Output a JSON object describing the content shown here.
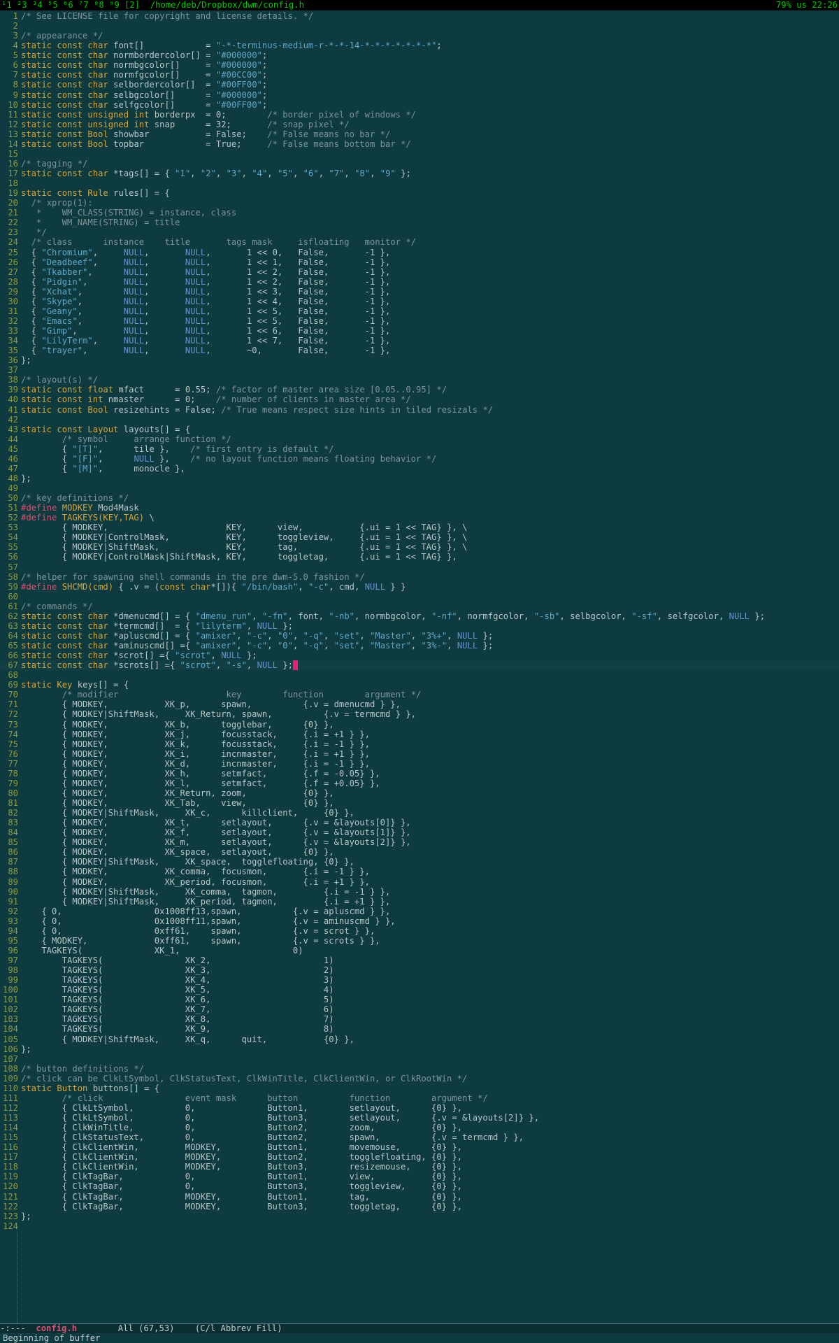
{
  "topbar": {
    "tags": "¹1 ²3 ³4 ⁵5 ⁶6 ⁷7 ⁸8 ⁹9 [2]",
    "path": "/home/deb/Dropbox/dwm/config.h",
    "status": "79% us 22:26"
  },
  "colors": {
    "background": "#0d3b3f",
    "keyword": "#d7a63a",
    "string": "#5fa8c8",
    "comment": "#7e9499",
    "line_number": "#8d9a43",
    "cursor": "#e8207a",
    "topbar_text": "#00cc00"
  },
  "editor": {
    "cursor_line": 67,
    "lines": [
      "/* See LICENSE file for copyright and license details. */",
      "",
      "/* appearance */",
      "static const char font[]            = \"-*-terminus-medium-r-*-*-14-*-*-*-*-*-*-*\";",
      "static const char normbordercolor[] = \"#000000\";",
      "static const char normbgcolor[]     = \"#000000\";",
      "static const char normfgcolor[]     = \"#00CC00\";",
      "static const char selbordercolor[]  = \"#00FF00\";",
      "static const char selbgcolor[]      = \"#000000\";",
      "static const char selfgcolor[]      = \"#00FF00\";",
      "static const unsigned int borderpx  = 0;        /* border pixel of windows */",
      "static const unsigned int snap      = 32;       /* snap pixel */",
      "static const Bool showbar           = False;    /* False means no bar */",
      "static const Bool topbar            = True;     /* False means bottom bar */",
      "",
      "/* tagging */",
      "static const char *tags[] = { \"1\", \"2\", \"3\", \"4\", \"5\", \"6\", \"7\", \"8\", \"9\" };",
      "",
      "static const Rule rules[] = {",
      "  /* xprop(1):",
      "   *    WM_CLASS(STRING) = instance, class",
      "   *    WM_NAME(STRING) = title",
      "   */",
      "  /* class      instance    title       tags mask     isfloating   monitor */",
      "  { \"Chromium\",     NULL,       NULL,       1 << 0,   False,       -1 },",
      "  { \"Deadbeef\",     NULL,       NULL,       1 << 1,   False,       -1 },",
      "  { \"Tkabber\",      NULL,       NULL,       1 << 2,   False,       -1 },",
      "  { \"Pidgin\",       NULL,       NULL,       1 << 2,   False,       -1 },",
      "  { \"Xchat\",        NULL,       NULL,       1 << 3,   False,       -1 },",
      "  { \"Skype\",        NULL,       NULL,       1 << 4,   False,       -1 },",
      "  { \"Geany\",        NULL,       NULL,       1 << 5,   False,       -1 },",
      "  { \"Emacs\",        NULL,       NULL,       1 << 5,   False,       -1 },",
      "  { \"Gimp\",         NULL,       NULL,       1 << 6,   False,       -1 },",
      "  { \"LilyTerm\",     NULL,       NULL,       1 << 7,   False,       -1 },",
      "  { \"trayer\",       NULL,       NULL,       ~0,       False,       -1 },",
      "};",
      "",
      "/* layout(s) */",
      "static const float mfact      = 0.55; /* factor of master area size [0.05..0.95] */",
      "static const int nmaster      = 0;    /* number of clients in master area */",
      "static const Bool resizehints = False; /* True means respect size hints in tiled resizals */",
      "",
      "static const Layout layouts[] = {",
      "        /* symbol     arrange function */",
      "        { \"[T]\",      tile },    /* first entry is default */",
      "        { \"[F]\",      NULL },    /* no layout function means floating behavior */",
      "        { \"[M]\",      monocle },",
      "};",
      "",
      "/* key definitions */",
      "#define MODKEY Mod4Mask",
      "#define TAGKEYS(KEY,TAG) \\",
      "        { MODKEY,                       KEY,      view,           {.ui = 1 << TAG} }, \\",
      "        { MODKEY|ControlMask,           KEY,      toggleview,     {.ui = 1 << TAG} }, \\",
      "        { MODKEY|ShiftMask,             KEY,      tag,            {.ui = 1 << TAG} }, \\",
      "        { MODKEY|ControlMask|ShiftMask, KEY,      toggletag,      {.ui = 1 << TAG} },",
      "",
      "/* helper for spawning shell commands in the pre dwm-5.0 fashion */",
      "#define SHCMD(cmd) { .v = (const char*[]){ \"/bin/bash\", \"-c\", cmd, NULL } }",
      "",
      "/* commands */",
      "static const char *dmenucmd[] = { \"dmenu_run\", \"-fn\", font, \"-nb\", normbgcolor, \"-nf\", normfgcolor, \"-sb\", selbgcolor, \"-sf\", selfgcolor, NULL };",
      "static const char *termcmd[]  = { \"lilyterm\", NULL };",
      "static const char *apluscmd[] = { \"amixer\", \"-c\", \"0\", \"-q\", \"set\", \"Master\", \"3%+\", NULL };",
      "static const char *aminuscmd[] ={ \"amixer\", \"-c\", \"0\", \"-q\", \"set\", \"Master\", \"3%-\", NULL };",
      "static const char *scrot[] ={ \"scrot\", NULL };",
      "static const char *scrots[] ={ \"scrot\", \"-s\", NULL };",
      "",
      "static Key keys[] = {",
      "        /* modifier                     key        function        argument */",
      "        { MODKEY,           XK_p,      spawn,          {.v = dmenucmd } },",
      "        { MODKEY|ShiftMask,     XK_Return, spawn,          {.v = termcmd } },",
      "        { MODKEY,           XK_b,      togglebar,      {0} },",
      "        { MODKEY,           XK_j,      focusstack,     {.i = +1 } },",
      "        { MODKEY,           XK_k,      focusstack,     {.i = -1 } },",
      "        { MODKEY,           XK_i,      incnmaster,     {.i = +1 } },",
      "        { MODKEY,           XK_d,      incnmaster,     {.i = -1 } },",
      "        { MODKEY,           XK_h,      setmfact,       {.f = -0.05} },",
      "        { MODKEY,           XK_l,      setmfact,       {.f = +0.05} },",
      "        { MODKEY,           XK_Return, zoom,           {0} },",
      "        { MODKEY,           XK_Tab,    view,           {0} },",
      "        { MODKEY|ShiftMask,     XK_c,      killclient,     {0} },",
      "        { MODKEY,           XK_t,      setlayout,      {.v = &layouts[0]} },",
      "        { MODKEY,           XK_f,      setlayout,      {.v = &layouts[1]} },",
      "        { MODKEY,           XK_m,      setlayout,      {.v = &layouts[2]} },",
      "        { MODKEY,           XK_space,  setlayout,      {0} },",
      "        { MODKEY|ShiftMask,     XK_space,  togglefloating, {0} },",
      "        { MODKEY,           XK_comma,  focusmon,       {.i = -1 } },",
      "        { MODKEY,           XK_period, focusmon,       {.i = +1 } },",
      "        { MODKEY|ShiftMask,     XK_comma,  tagmon,         {.i = -1 } },",
      "        { MODKEY|ShiftMask,     XK_period, tagmon,         {.i = +1 } },",
      "    { 0,                  0x1008ff13,spawn,          {.v = apluscmd } },",
      "    { 0,                  0x1008ff11,spawn,          {.v = aminuscmd } },",
      "    { 0,                  0xff61,    spawn,          {.v = scrot } },",
      "    { MODKEY,             0xff61,    spawn,          {.v = scrots } },",
      "    TAGKEYS(              XK_1,                      0)",
      "        TAGKEYS(                XK_2,                      1)",
      "        TAGKEYS(                XK_3,                      2)",
      "        TAGKEYS(                XK_4,                      3)",
      "        TAGKEYS(                XK_5,                      4)",
      "        TAGKEYS(                XK_6,                      5)",
      "        TAGKEYS(                XK_7,                      6)",
      "        TAGKEYS(                XK_8,                      7)",
      "        TAGKEYS(                XK_9,                      8)",
      "        { MODKEY|ShiftMask,     XK_q,      quit,           {0} },",
      "};",
      "",
      "/* button definitions */",
      "/* click can be ClkLtSymbol, ClkStatusText, ClkWinTitle, ClkClientWin, or ClkRootWin */",
      "static Button buttons[] = {",
      "        /* click                event mask      button          function        argument */",
      "        { ClkLtSymbol,          0,              Button1,        setlayout,      {0} },",
      "        { ClkLtSymbol,          0,              Button3,        setlayout,      {.v = &layouts[2]} },",
      "        { ClkWinTitle,          0,              Button2,        zoom,           {0} },",
      "        { ClkStatusText,        0,              Button2,        spawn,          {.v = termcmd } },",
      "        { ClkClientWin,         MODKEY,         Button1,        movemouse,      {0} },",
      "        { ClkClientWin,         MODKEY,         Button2,        togglefloating, {0} },",
      "        { ClkClientWin,         MODKEY,         Button3,        resizemouse,    {0} },",
      "        { ClkTagBar,            0,              Button1,        view,           {0} },",
      "        { ClkTagBar,            0,              Button3,        toggleview,     {0} },",
      "        { ClkTagBar,            MODKEY,         Button1,        tag,            {0} },",
      "        { ClkTagBar,            MODKEY,         Button3,        toggletag,      {0} },",
      "};",
      ""
    ]
  },
  "modeline": {
    "flags": "-:---",
    "buffer": "config.h",
    "position": "All (67,53)",
    "modes": "(C/l Abbrev Fill)"
  },
  "minibuffer": {
    "message": "Beginning of buffer"
  }
}
